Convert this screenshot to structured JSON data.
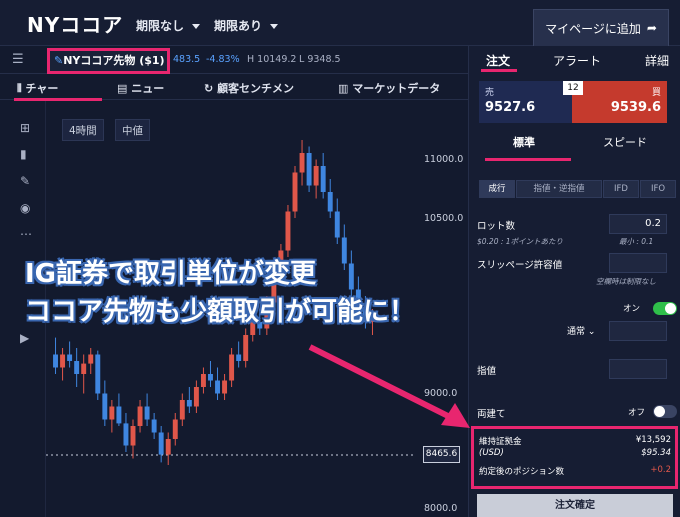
{
  "header": {
    "title": "NYココア",
    "expiry_none": "期限なし",
    "expiry_yes": "期限あり",
    "mypage_button": "マイページに追加"
  },
  "instrument": {
    "name": "NYココア先物 ($1)",
    "last": "483.5",
    "change_pct": "-4.83%",
    "high": "H 10149.2",
    "low": "L 9348.5"
  },
  "chart_tabs": [
    "チャー",
    "ニュー",
    "顧客センチメン",
    "マーケットデータ"
  ],
  "chart_controls": {
    "interval": "4時間",
    "price_type": "中値"
  },
  "y_axis": {
    "labels": [
      "11000.0",
      "10500.0",
      "9000.0",
      "8000.0"
    ],
    "current_price": "8465.6"
  },
  "overlay": {
    "line1": "IG証券で取引単位が変更",
    "line2": "ココア先物も少額取引が可能に！"
  },
  "order_panel": {
    "tabs": [
      "注文",
      "アラート",
      "詳細"
    ],
    "sell_label": "売",
    "sell_price": "9527.6",
    "buy_label": "買",
    "buy_price": "9539.6",
    "spread": "12",
    "mode_tabs": [
      "標準",
      "スピード"
    ],
    "order_types": [
      "成行",
      "指値・逆指値",
      "IFD",
      "IFO"
    ],
    "lot_label": "ロット数",
    "lot_value": "0.2",
    "lot_note": "$0.20 : 1ポイントあたり",
    "lot_min": "最小 : 0.1",
    "slippage_label": "スリッページ許容値",
    "slippage_note": "空欄時は制限なし",
    "stop_on": "オン",
    "stop_mode": "通常",
    "limit_label": "指値",
    "hedge_label": "両建て",
    "hedge_off": "オフ",
    "margin_label": "維持証拠金",
    "margin_value": "¥13,592",
    "margin_usd_label": "(USD)",
    "margin_usd_value": "$95.34",
    "position_label": "約定後のポジション数",
    "position_value": "+0.2",
    "confirm_button": "注文確定"
  },
  "colors": {
    "accent": "#e8266f",
    "sell": "#1f2a52",
    "buy": "#c53a2d",
    "up": "#e0574a",
    "down": "#3f86e0",
    "toggle_on": "#2fbf4a"
  },
  "chart_data": {
    "type": "candlestick",
    "ylim": [
      8000,
      11200
    ],
    "ohlc": [
      [
        9250,
        9380,
        9100,
        9150
      ],
      [
        9150,
        9300,
        9050,
        9250
      ],
      [
        9250,
        9350,
        9150,
        9200
      ],
      [
        9200,
        9300,
        9000,
        9100
      ],
      [
        9100,
        9250,
        8950,
        9180
      ],
      [
        9180,
        9300,
        9100,
        9250
      ],
      [
        9250,
        9280,
        8900,
        8950
      ],
      [
        8950,
        9050,
        8700,
        8750
      ],
      [
        8750,
        8900,
        8650,
        8850
      ],
      [
        8850,
        8950,
        8700,
        8720
      ],
      [
        8720,
        8800,
        8500,
        8550
      ],
      [
        8550,
        8750,
        8450,
        8700
      ],
      [
        8700,
        8900,
        8650,
        8850
      ],
      [
        8850,
        8950,
        8700,
        8750
      ],
      [
        8750,
        8800,
        8600,
        8650
      ],
      [
        8650,
        8700,
        8420,
        8480
      ],
      [
        8480,
        8650,
        8400,
        8600
      ],
      [
        8600,
        8800,
        8550,
        8750
      ],
      [
        8750,
        8950,
        8700,
        8900
      ],
      [
        8900,
        9000,
        8800,
        8850
      ],
      [
        8850,
        9050,
        8800,
        9000
      ],
      [
        9000,
        9150,
        8950,
        9100
      ],
      [
        9100,
        9200,
        9000,
        9050
      ],
      [
        9050,
        9150,
        8900,
        8950
      ],
      [
        8950,
        9100,
        8900,
        9050
      ],
      [
        9050,
        9300,
        9000,
        9250
      ],
      [
        9250,
        9350,
        9150,
        9200
      ],
      [
        9200,
        9450,
        9150,
        9400
      ],
      [
        9400,
        9550,
        9350,
        9500
      ],
      [
        9500,
        9600,
        9400,
        9450
      ],
      [
        9450,
        9700,
        9400,
        9650
      ],
      [
        9650,
        9900,
        9600,
        9850
      ],
      [
        9850,
        10100,
        9800,
        10050
      ],
      [
        10050,
        10400,
        10000,
        10350
      ],
      [
        10350,
        10700,
        10300,
        10650
      ],
      [
        10650,
        10900,
        10550,
        10800
      ],
      [
        10800,
        10850,
        10500,
        10550
      ],
      [
        10550,
        10750,
        10450,
        10700
      ],
      [
        10700,
        10800,
        10450,
        10500
      ],
      [
        10500,
        10600,
        10300,
        10350
      ],
      [
        10350,
        10450,
        10100,
        10150
      ],
      [
        10150,
        10250,
        9900,
        9950
      ],
      [
        9950,
        10050,
        9700,
        9750
      ],
      [
        9750,
        9850,
        9550,
        9600
      ],
      [
        9600,
        9700,
        9450,
        9500
      ],
      [
        9500,
        9600,
        9400,
        9527
      ]
    ]
  }
}
